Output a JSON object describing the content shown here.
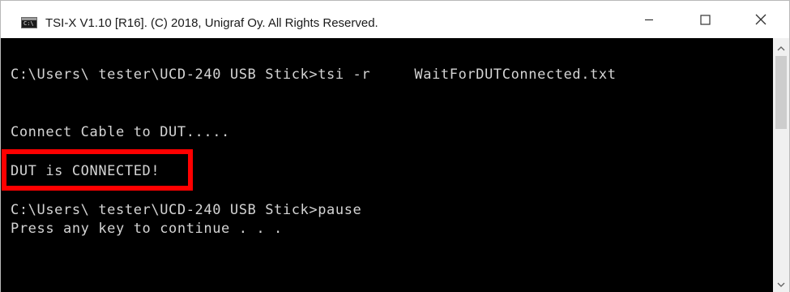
{
  "window": {
    "title": "TSI-X V1.10 [R16]. (C) 2018, Unigraf Oy. All Rights Reserved.",
    "app_icon_glyph": "C:\\",
    "controls": {
      "minimize_icon": "minimize-icon",
      "maximize_icon": "maximize-icon",
      "close_icon": "close-icon"
    }
  },
  "console": {
    "lines": [
      "C:\\Users\\ tester\\UCD-240 USB Stick>tsi -r     WaitForDUTConnected.txt",
      "Connect Cable to DUT.....",
      "DUT is CONNECTED!",
      "C:\\Users\\ tester\\UCD-240 USB Stick>pause",
      "Press any key to continue . . ."
    ]
  },
  "annotation": {
    "highlight_color": "#ff0000"
  },
  "colors": {
    "terminal_bg": "#000000",
    "terminal_text": "#d4d4d4",
    "titlebar_bg": "#ffffff"
  }
}
